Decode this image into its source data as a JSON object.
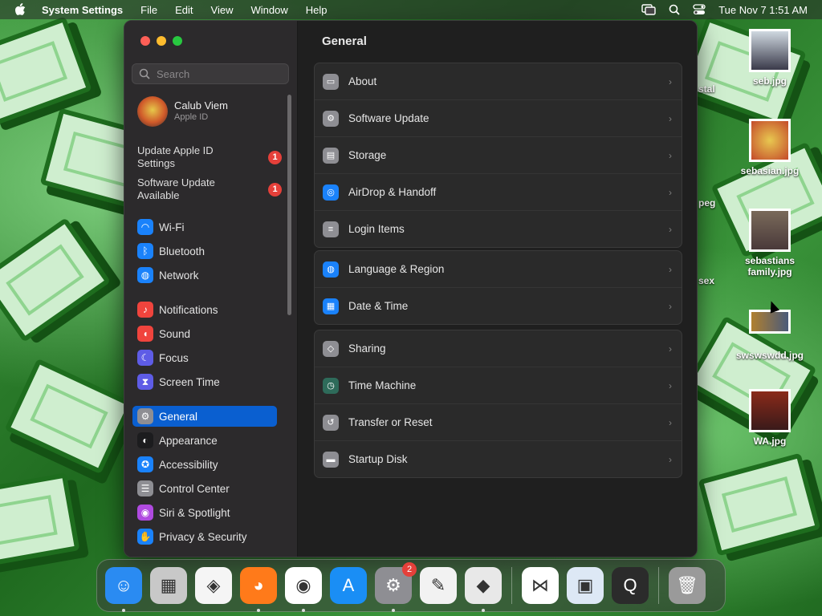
{
  "menubar": {
    "app_name": "System Settings",
    "menus": [
      "File",
      "Edit",
      "View",
      "Window",
      "Help"
    ],
    "datetime": "Tue Nov 7  1:51 AM"
  },
  "desktop": {
    "icons": [
      {
        "label": "seb.jpg"
      },
      {
        "label": "sebasian.jpg"
      },
      {
        "label": "sebastians family.jpg"
      },
      {
        "label": "swswswdd.jpg"
      },
      {
        "label": "WA.jpg"
      }
    ],
    "partial_labels": [
      "stal",
      "peg",
      "sex"
    ]
  },
  "window": {
    "search_placeholder": "Search",
    "profile": {
      "name": "Calub Viem",
      "sub": "Apple ID"
    },
    "alerts": [
      {
        "label": "Update Apple ID Settings",
        "badge": "1"
      },
      {
        "label": "Software Update Available",
        "badge": "1"
      }
    ],
    "sidebar": [
      {
        "label": "Wi-Fi",
        "icon": "wifi-icon",
        "color": "#1a82fb"
      },
      {
        "label": "Bluetooth",
        "icon": "bluetooth-icon",
        "color": "#1a82fb"
      },
      {
        "label": "Network",
        "icon": "globe-icon",
        "color": "#1a82fb"
      },
      {
        "label": "Notifications",
        "icon": "bell-icon",
        "color": "#f0443d"
      },
      {
        "label": "Sound",
        "icon": "speaker-icon",
        "color": "#f0443d"
      },
      {
        "label": "Focus",
        "icon": "moon-icon",
        "color": "#5e5ce6"
      },
      {
        "label": "Screen Time",
        "icon": "hourglass-icon",
        "color": "#5e5ce6"
      },
      {
        "label": "General",
        "icon": "gear-icon",
        "color": "#8e8e93"
      },
      {
        "label": "Appearance",
        "icon": "appearance-icon",
        "color": "#1c1c1e"
      },
      {
        "label": "Accessibility",
        "icon": "accessibility-icon",
        "color": "#1a82fb"
      },
      {
        "label": "Control Center",
        "icon": "control-center-icon",
        "color": "#8e8e93"
      },
      {
        "label": "Siri & Spotlight",
        "icon": "siri-icon",
        "color": "#b04ae0"
      },
      {
        "label": "Privacy & Security",
        "icon": "hand-icon",
        "color": "#1a82fb"
      }
    ],
    "selected": "General",
    "content": {
      "title": "General",
      "groups": [
        [
          {
            "label": "About",
            "icon": "display-icon"
          },
          {
            "label": "Software Update",
            "icon": "gear-icon"
          },
          {
            "label": "Storage",
            "icon": "storage-icon"
          },
          {
            "label": "AirDrop & Handoff",
            "icon": "airdrop-icon"
          },
          {
            "label": "Login Items",
            "icon": "list-icon"
          }
        ],
        [
          {
            "label": "Language & Region",
            "icon": "globe-icon"
          },
          {
            "label": "Date & Time",
            "icon": "calendar-icon"
          }
        ],
        [
          {
            "label": "Sharing",
            "icon": "sharing-icon"
          },
          {
            "label": "Time Machine",
            "icon": "clock-icon"
          },
          {
            "label": "Transfer or Reset",
            "icon": "reset-icon"
          },
          {
            "label": "Startup Disk",
            "icon": "disk-icon"
          }
        ]
      ]
    }
  },
  "dock": {
    "apps": [
      {
        "name": "finder-icon",
        "color": "#2a8bf2"
      },
      {
        "name": "launchpad-icon",
        "color": "#c8c8c8"
      },
      {
        "name": "safari-icon",
        "color": "#f5f5f5"
      },
      {
        "name": "firefox-icon",
        "color": "#ff7a1a"
      },
      {
        "name": "chrome-icon",
        "color": "#ffffff"
      },
      {
        "name": "app-store-icon",
        "color": "#1a8ef5"
      },
      {
        "name": "system-settings-icon",
        "color": "#8e8e93",
        "badge": "2"
      },
      {
        "name": "textedit-icon",
        "color": "#f2f2f2"
      },
      {
        "name": "roblox-icon",
        "color": "#e8e8e8"
      }
    ],
    "apps_after": [
      {
        "name": "visual-studio-icon",
        "color": "#ffffff"
      },
      {
        "name": "preview-icon",
        "color": "#dde8f5"
      },
      {
        "name": "quicktime-icon",
        "color": "#2b2b2b"
      }
    ],
    "trash": "trash-icon"
  }
}
